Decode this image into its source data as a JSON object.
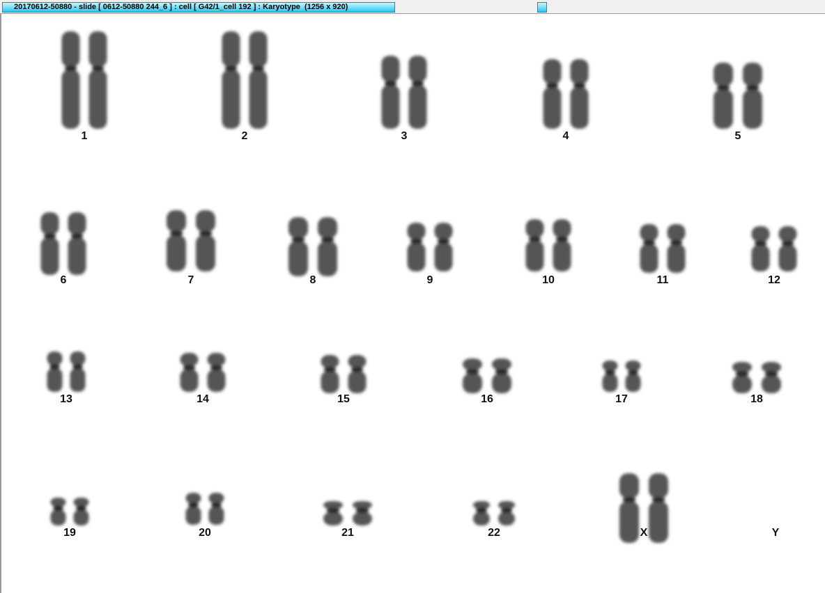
{
  "window": {
    "title": "20170612-50880 - slide [ 0612-50880 244_6 ] : cell [ G42/1_cell 192 ] : Karyotype  (1256 x 920)"
  },
  "karyotype": {
    "chromosome_color": "#555555",
    "labels": [
      "1",
      "2",
      "3",
      "4",
      "5",
      "6",
      "7",
      "8",
      "9",
      "10",
      "11",
      "12",
      "13",
      "14",
      "15",
      "16",
      "17",
      "18",
      "19",
      "20",
      "21",
      "22",
      "X",
      "Y"
    ]
  }
}
